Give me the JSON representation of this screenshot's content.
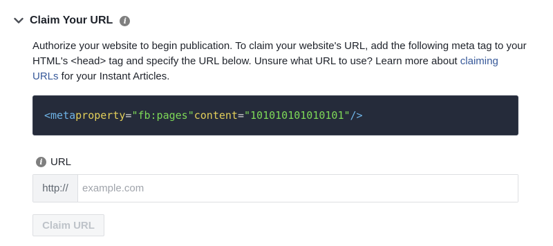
{
  "header": {
    "title": "Claim Your URL",
    "expand_icon": "chevron-down-icon",
    "info_icon": "info-icon",
    "info_glyph": "i"
  },
  "description": {
    "text_before_link": "Authorize your website to begin publication. To claim your website's URL, add the following meta tag to your HTML's <head> tag and specify the URL below. Unsure what URL to use? Learn more about ",
    "link_text": "claiming URLs",
    "text_after_link": " for your Instant Articles."
  },
  "code": {
    "tag_open": "<meta",
    "attr1": "property",
    "eq1": "=",
    "val1": "\"fb:pages\"",
    "attr2": "content",
    "eq2": "=",
    "val2": "\"101010101010101\"",
    "tag_close": "/>"
  },
  "url_form": {
    "label": "URL",
    "info_glyph": "i",
    "prefix": "http://",
    "value": "",
    "placeholder": "example.com",
    "button_label": "Claim URL",
    "button_disabled": true
  },
  "colors": {
    "code_background": "#252b3a",
    "code_tag": "#6fb3e6",
    "code_attr": "#e3cf5a",
    "code_string": "#7ed957",
    "link": "#365899",
    "disabled_text": "#bec3c9"
  }
}
